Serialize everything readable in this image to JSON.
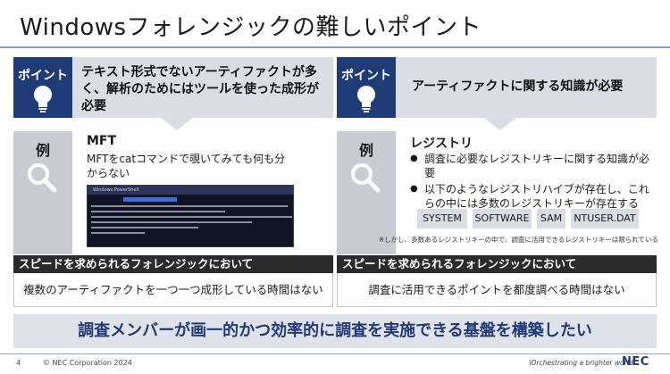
{
  "slide": {
    "title": "Windowsフォレンジックの難しいポイント",
    "banner": "調査メンバーが画一的かつ効率的に調査を実施できる基盤を構築したい"
  },
  "left": {
    "point_tag": "ポイント",
    "point_text": "テキスト形式でないアーティファクトが多く、解析のためにはツールを使った成形が必要",
    "example_tag": "例",
    "example_title": "MFT",
    "example_desc": "MFTをcatコマンドで覗いてみても何も分からない",
    "terminal_title": "Windows PowerShell",
    "speed_header": "スピードを求められるフォレンジックにおいて",
    "speed_text": "複数のアーティファクトを一つ一つ成形している時間はない"
  },
  "right": {
    "point_tag": "ポイント",
    "point_text": "アーティファクトに関する知識が必要",
    "example_tag": "例",
    "example_title": "レジストリ",
    "bullets": [
      "調査に必要なレジストリキーに関する知識が必要",
      "以下のようなレジストリハイブが存在し、これらの中には多数のレジストリキーが存在する"
    ],
    "hives": [
      "SYSTEM",
      "SOFTWARE",
      "SAM",
      "NTUSER.DAT"
    ],
    "note": "※しかし、多数あるレジストリキーの中で、調査に活用できるレジストリキーは限られている",
    "speed_header": "スピードを求められるフォレンジックにおいて",
    "speed_text": "調査に活用できるポイントを都度調べる時間はない"
  },
  "footer": {
    "page_number": "4",
    "copyright": "© NEC Corporation 2024",
    "tagline": "\\Orchestrating a brighter world",
    "logo": "NEC"
  },
  "colors": {
    "accent_navy": "#1f3b78",
    "panel_gray": "#dadde3",
    "tag_gray": "#c9ccd2",
    "speed_bar": "#2b2b2b"
  },
  "icons": [
    "lightbulb-icon",
    "magnifier-icon"
  ]
}
